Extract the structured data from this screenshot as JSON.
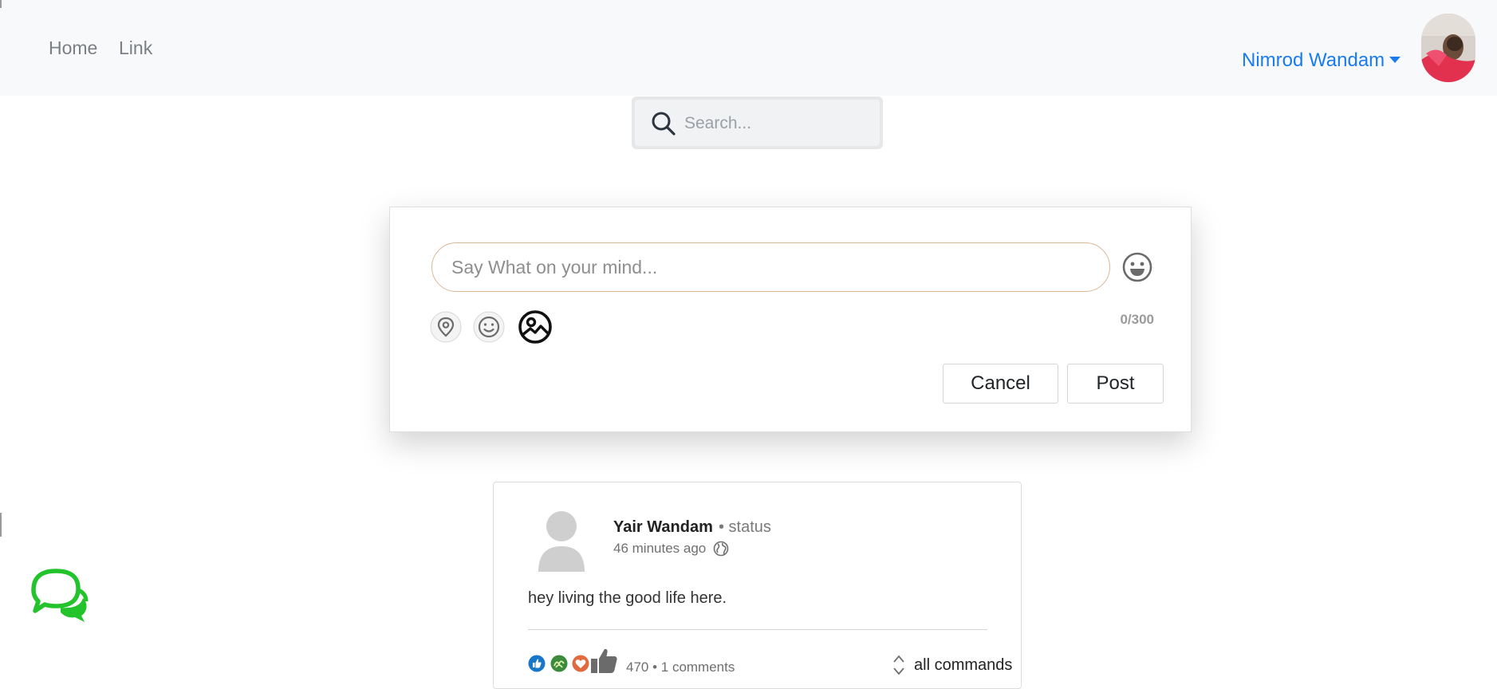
{
  "navbar": {
    "links": [
      "Home",
      "Link"
    ],
    "user_name": "Nimrod Wandam"
  },
  "search": {
    "placeholder": "Search..."
  },
  "composer": {
    "placeholder": "Say What on your mind...",
    "counter": "0/300",
    "cancel_label": "Cancel",
    "post_label": "Post",
    "tools": [
      "location-icon",
      "smile-icon",
      "image-icon"
    ]
  },
  "post": {
    "author": "Yair Wandam",
    "type": "• status",
    "time": "46 minutes ago",
    "text": "hey living the good life here.",
    "reaction_summary": "470 • 1 comments",
    "sort_label": "all commands"
  },
  "colors": {
    "brand": "#1a7bf0",
    "chat": "#22c32b",
    "navbar_bg": "#f8f9fa"
  }
}
